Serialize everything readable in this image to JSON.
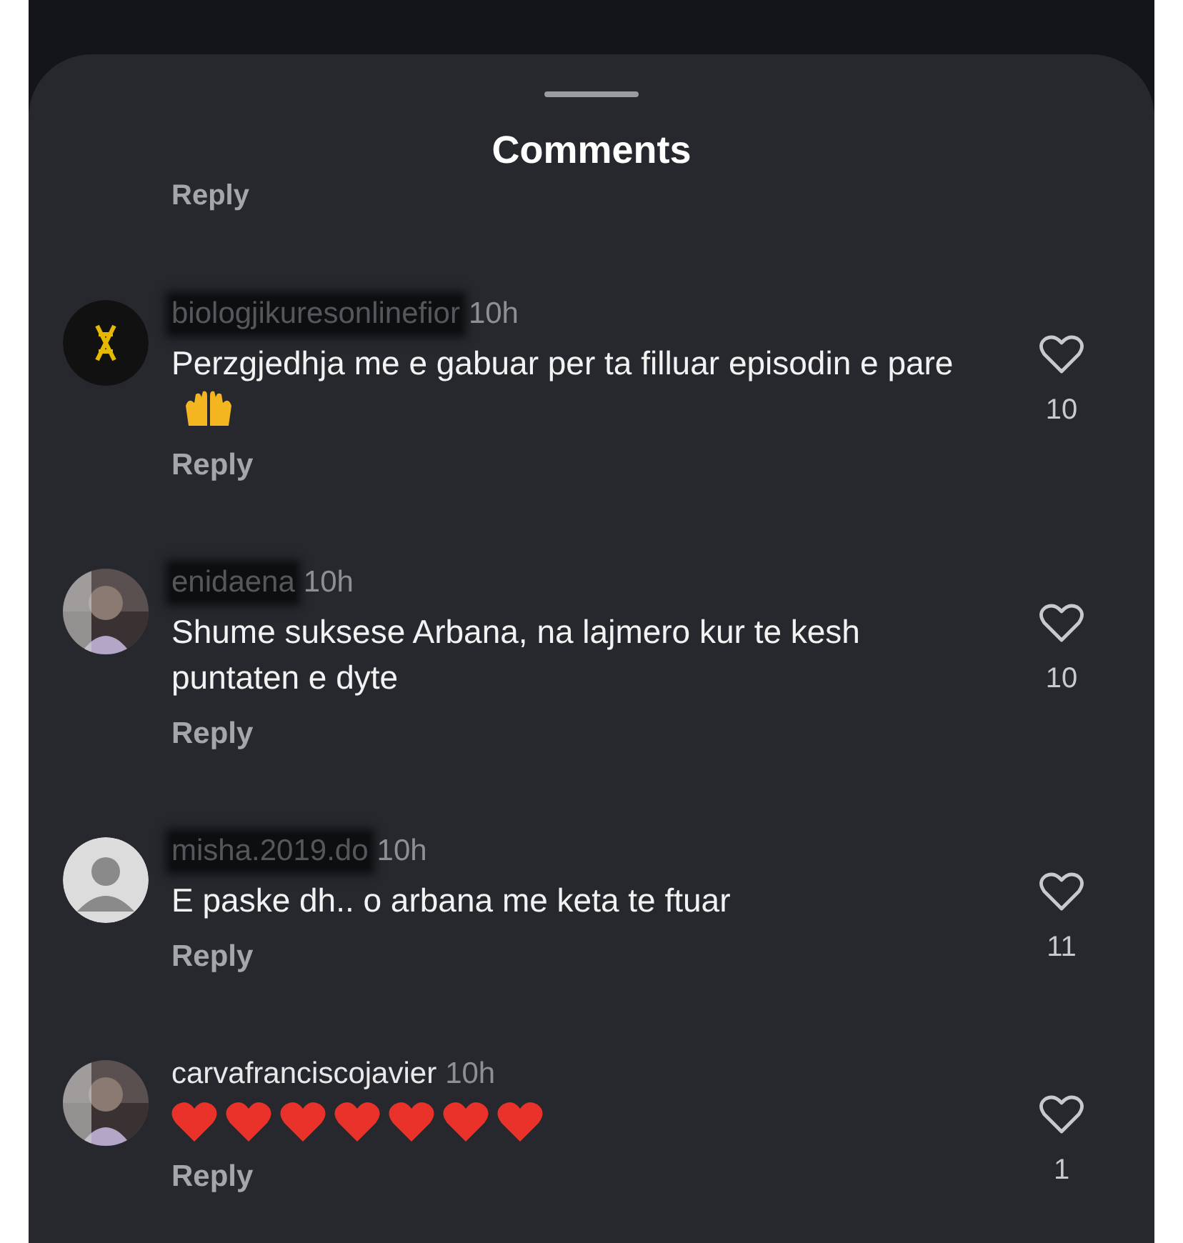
{
  "sheet": {
    "title": "Comments",
    "partial_reply": "Reply"
  },
  "comments": [
    {
      "kind": "dna",
      "username": "biologjikuresonlinefior",
      "redacted": true,
      "time": "10h",
      "text": "Perzgjedhja me e gabuar per ta filluar episodin e pare",
      "emojis": [
        {
          "kind": "raised_hands"
        }
      ],
      "likes": "10",
      "liked": false,
      "reply": "Reply"
    },
    {
      "username": "enidaena",
      "redacted": true,
      "time": "10h",
      "text": "Shume suksese Arbana, na lajmero kur te kesh puntaten e dyte",
      "likes": "10",
      "liked": false,
      "reply": "Reply"
    },
    {
      "kind": "default",
      "username": "misha.2019.do",
      "redacted": true,
      "time": "10h",
      "text": "E paske dh.. o arbana me keta te ftuar",
      "likes": "11",
      "liked": false,
      "reply": "Reply"
    },
    {
      "username": "carvafranciscojavier",
      "redacted": false,
      "time": "10h",
      "emojis": [
        {
          "kind": "red_heart"
        },
        {
          "kind": "red_heart"
        },
        {
          "kind": "red_heart"
        },
        {
          "kind": "red_heart"
        },
        {
          "kind": "red_heart"
        },
        {
          "kind": "red_heart"
        },
        {
          "kind": "red_heart"
        }
      ],
      "likes": "1",
      "liked": false,
      "reply": "Reply"
    }
  ]
}
